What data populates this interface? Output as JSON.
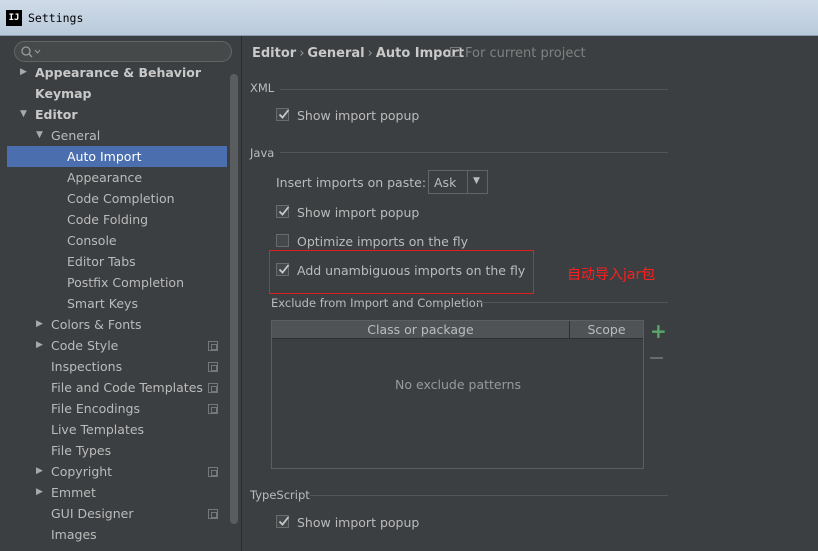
{
  "window": {
    "title": "Settings",
    "logo": "IJ"
  },
  "search": {
    "icon": "search-icon"
  },
  "tree": [
    {
      "label": "Appearance & Behavior",
      "arrow": "right",
      "bold": true
    },
    {
      "label": "Keymap",
      "arrow": "",
      "bold": true
    },
    {
      "label": "Editor",
      "arrow": "down",
      "bold": true
    },
    {
      "label": "General",
      "arrow": "down"
    },
    {
      "label": "Auto Import",
      "selected": true
    },
    {
      "label": "Appearance"
    },
    {
      "label": "Code Completion"
    },
    {
      "label": "Code Folding"
    },
    {
      "label": "Console"
    },
    {
      "label": "Editor Tabs"
    },
    {
      "label": "Postfix Completion"
    },
    {
      "label": "Smart Keys"
    },
    {
      "label": "Colors & Fonts",
      "arrow": "right"
    },
    {
      "label": "Code Style",
      "arrow": "right",
      "project": true
    },
    {
      "label": "Inspections",
      "project": true
    },
    {
      "label": "File and Code Templates",
      "project": true
    },
    {
      "label": "File Encodings",
      "project": true
    },
    {
      "label": "Live Templates"
    },
    {
      "label": "File Types"
    },
    {
      "label": "Copyright",
      "arrow": "right",
      "project": true
    },
    {
      "label": "Emmet",
      "arrow": "right"
    },
    {
      "label": "GUI Designer",
      "project": true
    },
    {
      "label": "Images"
    }
  ],
  "breadcrumb": {
    "part1": "Editor",
    "part2": "General",
    "part3": "Auto Import",
    "sep": "›",
    "scope": "For current project"
  },
  "xml": {
    "title": "XML",
    "show_popup": {
      "label": "Show import popup",
      "checked": true
    }
  },
  "java": {
    "title": "Java",
    "paste_label": "Insert imports on paste:",
    "paste_value": "Ask",
    "show_popup": {
      "label": "Show import popup",
      "checked": true
    },
    "optimize": {
      "label": "Optimize imports on the fly",
      "checked": false
    },
    "unambiguous": {
      "label": "Add unambiguous imports on the fly",
      "checked": true
    }
  },
  "exclude": {
    "title": "Exclude from Import and Completion",
    "col_class": "Class or package",
    "col_scope": "Scope",
    "empty": "No exclude patterns",
    "add": "+",
    "remove": "−"
  },
  "typescript": {
    "title": "TypeScript",
    "show_popup": {
      "label": "Show import popup",
      "checked": true
    }
  },
  "annotation": "自动导入jar包",
  "colors": {
    "selection": "#4b6eaf",
    "annotation": "#ff1e1e",
    "add": "#59a869"
  }
}
